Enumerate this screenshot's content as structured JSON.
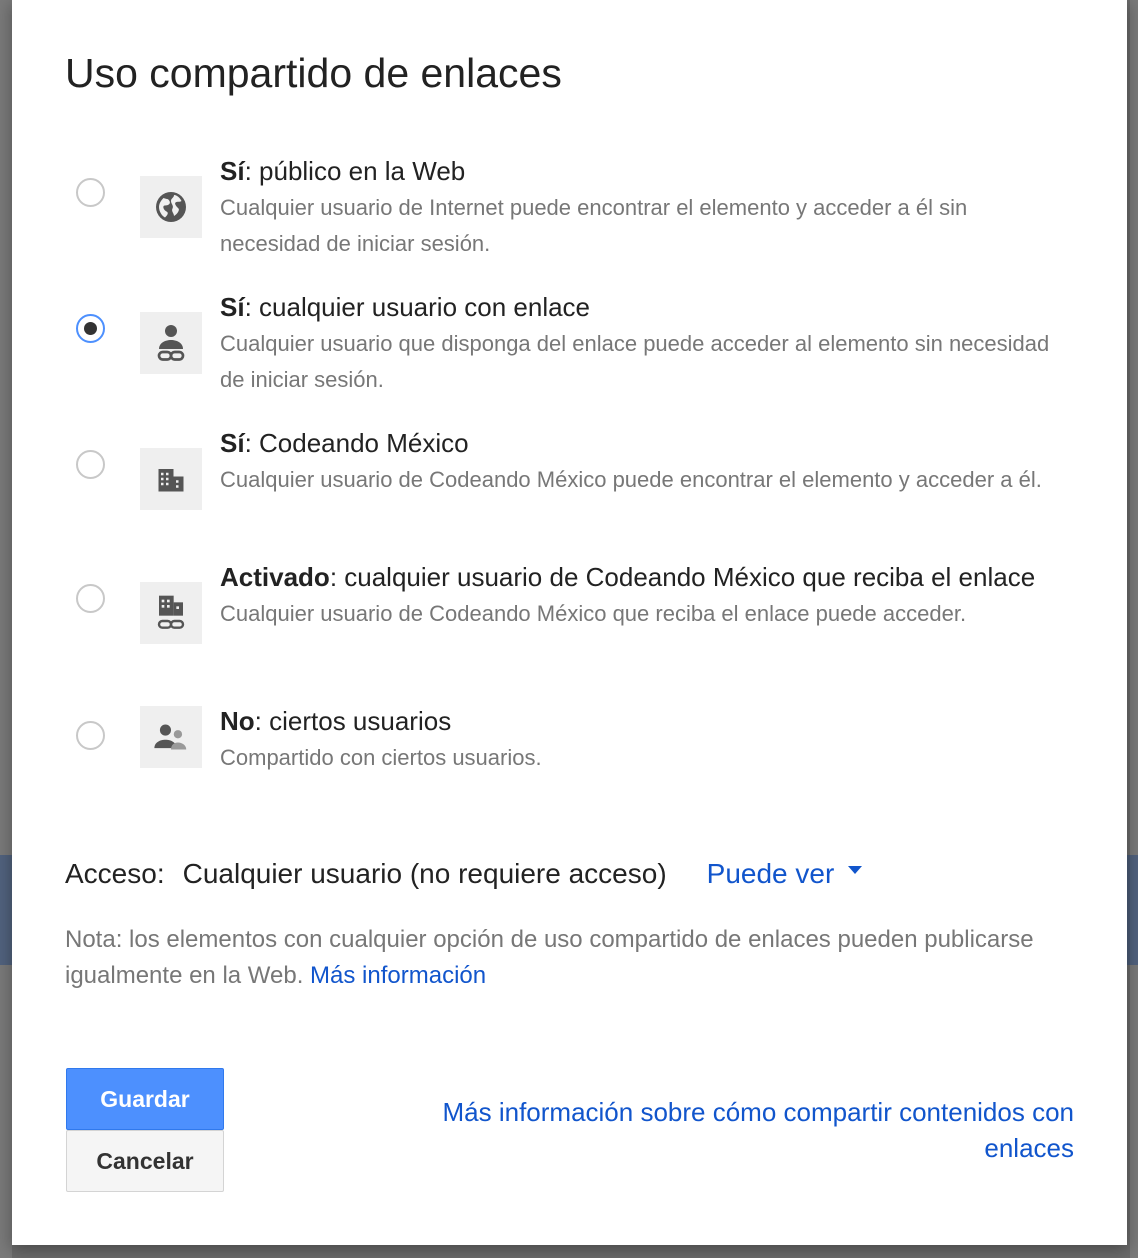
{
  "dialog": {
    "title": "Uso compartido de enlaces",
    "options": [
      {
        "title_bold": "Sí",
        "title_rest": ": público en la Web",
        "description": "Cualquier usuario de Internet puede encontrar el elemento y acceder a él sin necesidad de iniciar sesión.",
        "icon": "globe-icon",
        "selected": false
      },
      {
        "title_bold": "Sí",
        "title_rest": ": cualquier usuario con enlace",
        "description": "Cualquier usuario que disponga del enlace puede acceder al elemento sin necesidad de iniciar sesión.",
        "icon": "person-link-icon",
        "selected": true
      },
      {
        "title_bold": "Sí",
        "title_rest": ": Codeando México",
        "description": "Cualquier usuario de Codeando México puede encontrar el elemento y acceder a él.",
        "icon": "building-icon",
        "selected": false
      },
      {
        "title_bold": "Activado",
        "title_rest": ": cualquier usuario de Codeando México que reciba el enlace",
        "description": "Cualquier usuario de Codeando México que reciba el enlace puede acceder.",
        "icon": "building-link-icon",
        "selected": false
      },
      {
        "title_bold": "No",
        "title_rest": ": ciertos usuarios",
        "description": "Compartido con ciertos usuarios.",
        "icon": "people-icon",
        "selected": false
      }
    ],
    "access": {
      "label": "Acceso:",
      "value": "Cualquier usuario (no requiere acceso)",
      "permission": "Puede ver"
    },
    "note": {
      "text": "Nota: los elementos con cualquier opción de uso compartido de enlaces pueden publicarse igualmente en la Web.",
      "link": "Más información"
    },
    "buttons": {
      "save": "Guardar",
      "cancel": "Cancelar"
    },
    "help_link": "Más información sobre cómo compartir contenidos con enlaces"
  },
  "colors": {
    "accent": "#4d90fe",
    "link": "#1155cc",
    "muted_text": "#777777"
  }
}
